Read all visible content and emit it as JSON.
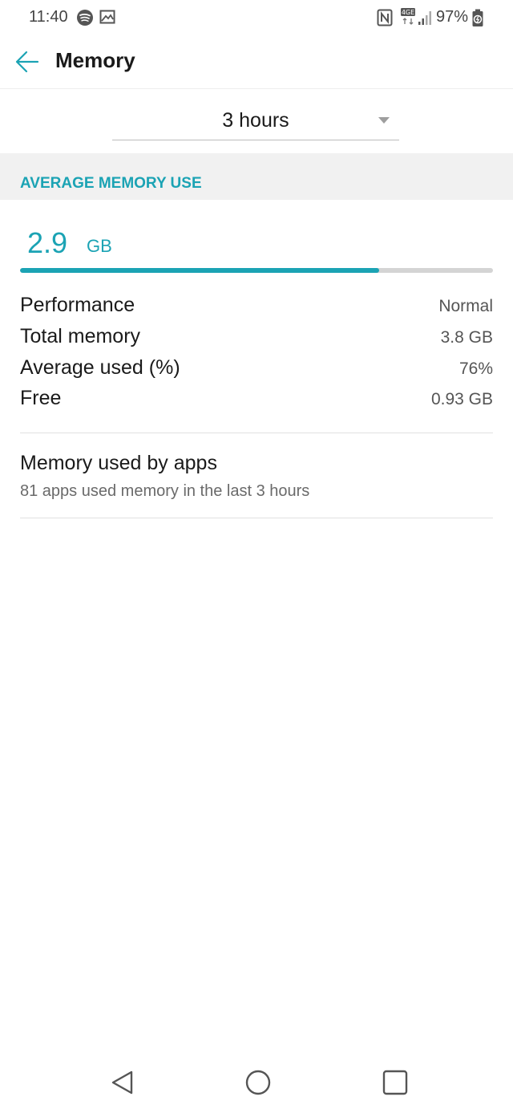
{
  "status_bar": {
    "time": "11:40",
    "battery": "97%",
    "network": "4GE",
    "icons": [
      "spotify-icon",
      "image-icon",
      "nfc-icon",
      "signal-icon",
      "battery-saver-icon"
    ]
  },
  "header": {
    "title": "Memory",
    "back_icon": "arrow-back-icon"
  },
  "period_select": {
    "value": "3 hours"
  },
  "section": {
    "title": "AVERAGE MEMORY USE"
  },
  "usage": {
    "value": "2.9",
    "unit": "GB",
    "used_fraction": 0.76
  },
  "stats": [
    {
      "label": "Performance",
      "value": "Normal"
    },
    {
      "label": "Total memory",
      "value": "3.8 GB"
    },
    {
      "label": "Average used (%)",
      "value": "76%"
    },
    {
      "label": "Free",
      "value": "0.93 GB"
    }
  ],
  "apps": {
    "title": "Memory used by apps",
    "subtitle": "81 apps used memory in the last 3 hours"
  },
  "colors": {
    "accent": "#1ba3b4",
    "track": "#d4d4d4",
    "section_bg": "#f1f1f1"
  }
}
